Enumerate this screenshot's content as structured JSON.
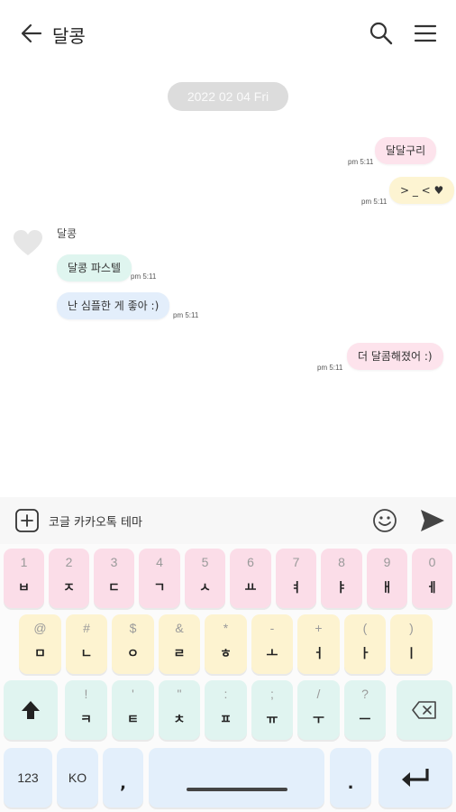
{
  "header": {
    "title": "달콩",
    "back_icon": "arrow-left-icon",
    "search_icon": "search-icon",
    "menu_icon": "hamburger-menu-icon"
  },
  "chat": {
    "date": "2022 02 04 Fri",
    "messages": [
      {
        "text": "달달구리",
        "time": "pm 5:11",
        "side": "right",
        "color": "pink"
      },
      {
        "text": "> _ < ♥",
        "time": "pm 5:11",
        "side": "right",
        "color": "yellow"
      },
      {
        "text": "달콩 파스텔",
        "time": "pm 5:11",
        "side": "left",
        "color": "mint"
      },
      {
        "text": "난 심플한 게 좋아 :)",
        "time": "pm 5:11",
        "side": "left",
        "color": "blue"
      },
      {
        "text": "더 달콤해졌어 :)",
        "time": "pm 5:11",
        "side": "right",
        "color": "pink"
      }
    ],
    "sender_name": "달콩"
  },
  "input": {
    "text": "코글 카카오톡 테마",
    "add_icon": "plus-square-icon",
    "emoji_icon": "smiley-icon",
    "send_icon": "send-icon"
  },
  "keyboard": {
    "row1": [
      {
        "sub": "1",
        "main": "ㅂ"
      },
      {
        "sub": "2",
        "main": "ㅈ"
      },
      {
        "sub": "3",
        "main": "ㄷ"
      },
      {
        "sub": "4",
        "main": "ㄱ"
      },
      {
        "sub": "5",
        "main": "ㅅ"
      },
      {
        "sub": "6",
        "main": "ㅛ"
      },
      {
        "sub": "7",
        "main": "ㅕ"
      },
      {
        "sub": "8",
        "main": "ㅑ"
      },
      {
        "sub": "9",
        "main": "ㅐ"
      },
      {
        "sub": "0",
        "main": "ㅔ"
      }
    ],
    "row2": [
      {
        "sub": "@",
        "main": "ㅁ"
      },
      {
        "sub": "#",
        "main": "ㄴ"
      },
      {
        "sub": "$",
        "main": "ㅇ"
      },
      {
        "sub": "&",
        "main": "ㄹ"
      },
      {
        "sub": "*",
        "main": "ㅎ"
      },
      {
        "sub": "-",
        "main": "ㅗ"
      },
      {
        "sub": "+",
        "main": "ㅓ"
      },
      {
        "sub": "(",
        "main": "ㅏ"
      },
      {
        "sub": ")",
        "main": "ㅣ"
      }
    ],
    "row3": [
      {
        "sub": "!",
        "main": "ㅋ"
      },
      {
        "sub": "'",
        "main": "ㅌ"
      },
      {
        "sub": "\"",
        "main": "ㅊ"
      },
      {
        "sub": ":",
        "main": "ㅍ"
      },
      {
        "sub": ";",
        "main": "ㅠ"
      },
      {
        "sub": "/",
        "main": "ㅜ"
      },
      {
        "sub": "?",
        "main": "ㅡ"
      }
    ],
    "shift_icon": "shift-arrow-icon",
    "backspace_icon": "backspace-icon",
    "num_label": "123",
    "lang_label": "KO",
    "comma": ",",
    "period": ".",
    "enter_icon": "enter-return-icon"
  },
  "colors": {
    "pink": "#fbdde8",
    "yellow": "#fdf3d0",
    "mint": "#e0f4f0",
    "blue": "#e3effb"
  }
}
